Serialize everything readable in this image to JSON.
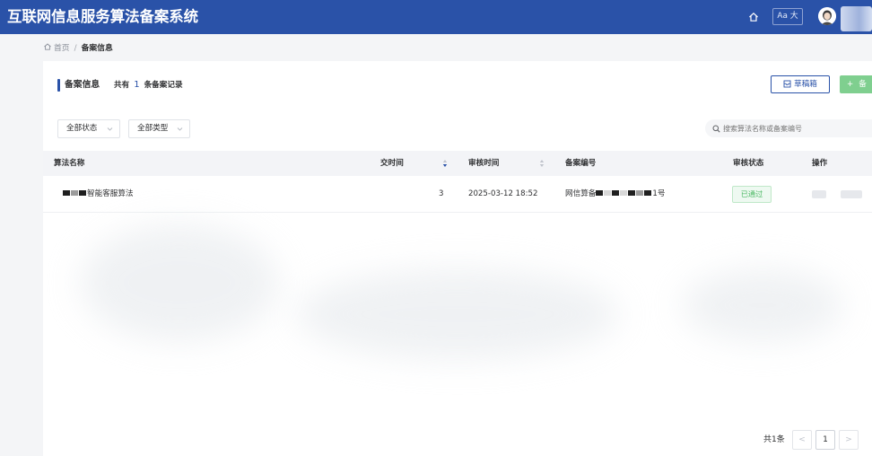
{
  "header": {
    "app_title": "互联网信息服务算法备案系统",
    "font_toggle": "Aa 大"
  },
  "breadcrumb": {
    "home": "首页",
    "separator": "/",
    "current": "备案信息"
  },
  "section": {
    "title": "备案信息",
    "summary_prefix": "共有",
    "record_count": "1",
    "summary_suffix": "条备案记录"
  },
  "toolbar": {
    "draft_label": "草稿箱",
    "add_label": "备",
    "add_symbol": "+"
  },
  "filters": {
    "status": "全部状态",
    "type": "全部类型",
    "search_placeholder": "搜索算法名称或备案编号"
  },
  "table": {
    "columns": {
      "name": "算法名称",
      "submit_time": "交时间",
      "review_time": "审核时间",
      "filing_no": "备案编号",
      "review_status": "审核状态",
      "actions": "操作"
    },
    "rows": [
      {
        "name": "智能客服算法",
        "submit_value": "3",
        "review_time": "2025-03-12 18:52",
        "filing_prefix": "网信算备",
        "filing_suffix": "1号",
        "status": "已通过"
      }
    ]
  },
  "pagination": {
    "total": "共1条",
    "prev": "<",
    "current_page": "1",
    "next": ">"
  },
  "colors": {
    "header_bg": "#2a52a8",
    "accent": "#2a52a8",
    "success": "#4cb964",
    "add_button": "#7fcf8f"
  }
}
